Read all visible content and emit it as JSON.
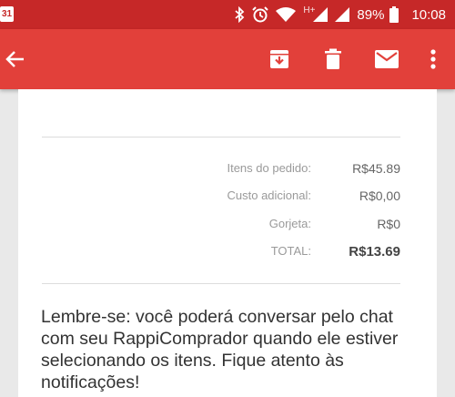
{
  "status_bar": {
    "calendar_day": "31",
    "network_type": "H+",
    "battery_percent": "89%",
    "time": "10:08"
  },
  "app_bar": {
    "icons": [
      "back-arrow-icon",
      "archive-icon",
      "trash-icon",
      "mail-icon",
      "more-vert-icon"
    ]
  },
  "order": {
    "rows": [
      {
        "label": "Itens do pedido:",
        "value": "R$45.89"
      },
      {
        "label": "Custo adicional:",
        "value": "R$0,00"
      },
      {
        "label": "Gorjeta:",
        "value": "R$0"
      },
      {
        "label": "TOTAL:",
        "value": "R$13.69"
      }
    ]
  },
  "note": "Lembre-se: você poderá conversar pelo chat com seu RappiComprador quando ele estiver selecionando os itens. Fique atento às notificações!",
  "colors": {
    "status_bar": "#c62828",
    "app_bar": "#e2403a"
  }
}
